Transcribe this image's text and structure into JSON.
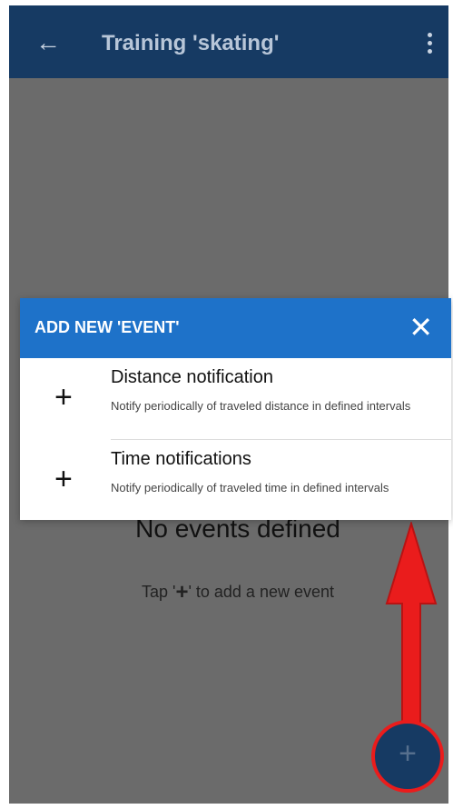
{
  "app_bar": {
    "title": "Training 'skating'",
    "back_icon": "arrow-left-icon",
    "menu_icon": "more-vertical-icon"
  },
  "empty_state": {
    "title": "No events defined",
    "hint_prefix": "Tap '",
    "hint_symbol": "+",
    "hint_suffix": "' to add a new event"
  },
  "dialog": {
    "title": "ADD NEW 'EVENT'",
    "close_icon": "close-icon",
    "items": [
      {
        "icon": "plus-icon",
        "label": "Distance notification",
        "description": "Notify periodically of traveled distance in defined intervals"
      },
      {
        "icon": "plus-icon",
        "label": "Time notifications",
        "description": "Notify periodically of traveled time in defined intervals"
      }
    ]
  },
  "fab": {
    "icon": "plus-icon",
    "symbol": "+"
  },
  "colors": {
    "app_bar": "#163a63",
    "dialog_header": "#1e72c9",
    "highlight": "#ea1c1c"
  }
}
